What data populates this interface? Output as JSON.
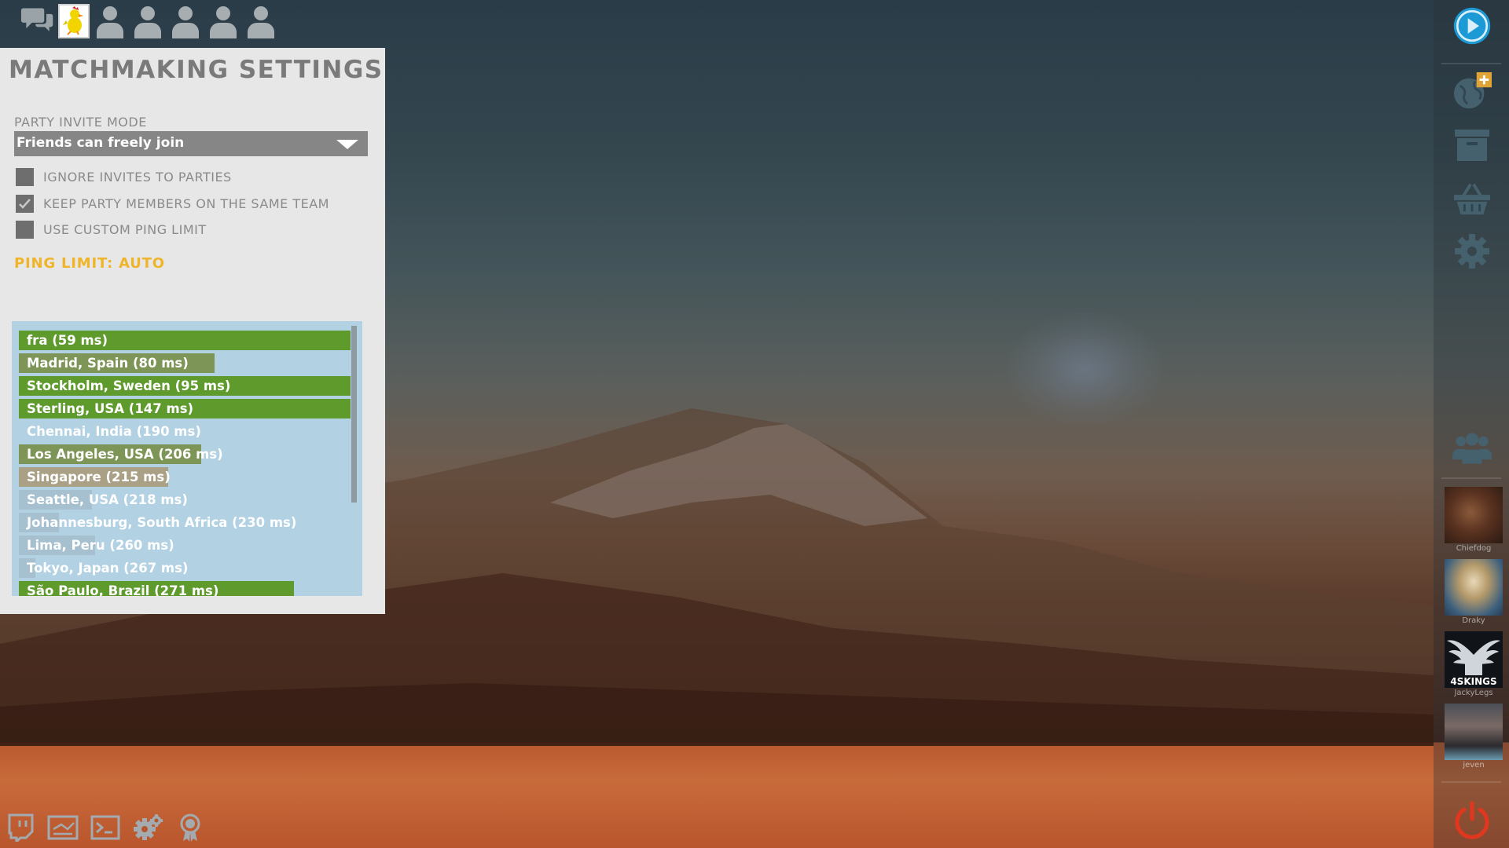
{
  "party_bar": {
    "chat_icon": "chat-bubbles-icon",
    "self_avatar": "chicken-avatar",
    "empty_slots": 5
  },
  "settings": {
    "title": "MATCHMAKING SETTINGS",
    "party_invite_mode_label": "PARTY INVITE MODE",
    "party_invite_mode_value": "Friends can freely join",
    "options": [
      {
        "label": "IGNORE INVITES TO PARTIES",
        "checked": false
      },
      {
        "label": "KEEP PARTY MEMBERS ON THE SAME TEAM",
        "checked": true
      },
      {
        "label": "USE CUSTOM PING LIMIT",
        "checked": false
      }
    ],
    "ping_limit": "PING LIMIT: AUTO",
    "regions": [
      {
        "label": "fra (59 ms)",
        "fill": 1.0,
        "color": "#5e9a2c"
      },
      {
        "label": "Madrid, Spain (80 ms)",
        "fill": 0.59,
        "color": "#7d9556"
      },
      {
        "label": "Stockholm, Sweden (95 ms)",
        "fill": 1.0,
        "color": "#5e9a2c"
      },
      {
        "label": "Sterling, USA (147 ms)",
        "fill": 1.0,
        "color": "#5e9a2c"
      },
      {
        "label": "Chennai, India (190 ms)",
        "fill": 0.0,
        "color": "#5e9a2c"
      },
      {
        "label": "Los Angeles, USA (206 ms)",
        "fill": 0.55,
        "color": "#7d9556"
      },
      {
        "label": "Singapore (215 ms)",
        "fill": 0.45,
        "color": "#a9a086"
      },
      {
        "label": "Seattle, USA (218 ms)",
        "fill": 0.22,
        "color": "#a6c0cf"
      },
      {
        "label": "Johannesburg, South Africa (230 ms)",
        "fill": 0.12,
        "color": "#a6c0cf"
      },
      {
        "label": "Lima, Peru (260 ms)",
        "fill": 0.23,
        "color": "#a6c0cf"
      },
      {
        "label": "Tokyo, Japan (267 ms)",
        "fill": 0.05,
        "color": "#a6c0cf"
      },
      {
        "label": "São Paulo, Brazil (271 ms)",
        "fill": 0.83,
        "color": "#5e9a2c"
      }
    ]
  },
  "sidebar": {
    "icons": [
      "play-icon",
      "globe-add-icon",
      "archive-icon",
      "basket-icon",
      "gear-icon",
      "friends-icon",
      "power-icon"
    ],
    "friends": [
      {
        "name": "Chiefdog"
      },
      {
        "name": "Draky"
      },
      {
        "name": "JackyLegs",
        "badge": "4SKINGS"
      },
      {
        "name": "jeven"
      }
    ]
  },
  "bottom_tools": [
    "twitch-icon",
    "network-icon",
    "console-icon",
    "settings-icon",
    "achievement-icon"
  ],
  "colors": {
    "accent_orange": "#f0b429",
    "play_blue": "#1c9ad6",
    "power_red": "#e2371f",
    "ping_good": "#5e9a2c"
  }
}
